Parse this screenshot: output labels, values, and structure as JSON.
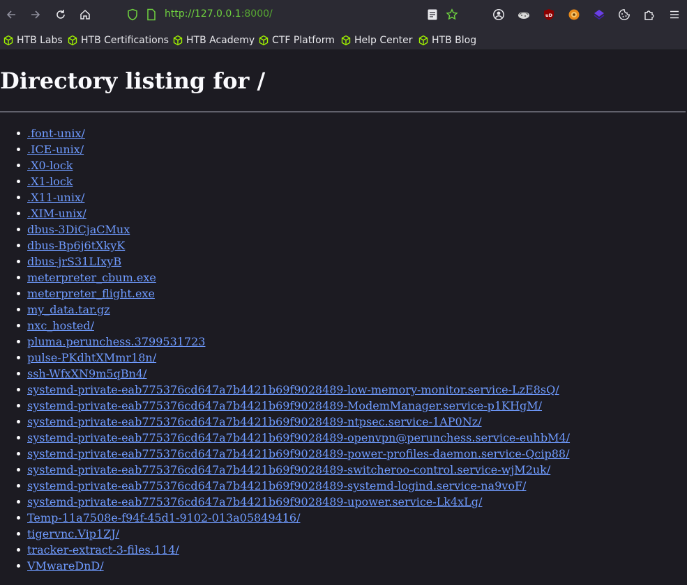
{
  "browser": {
    "url_host": "http://127.0.0.1",
    "url_port": ":8000/",
    "icons": {
      "back": "arrow-left-icon",
      "forward": "arrow-right-icon",
      "reload": "reload-icon",
      "home": "home-icon",
      "shield": "shield-icon",
      "page": "page-icon",
      "reader": "reader-view-icon",
      "bookmark_star": "star-icon",
      "account": "account-icon",
      "menu": "hamburger-menu-icon"
    }
  },
  "bookmarks": [
    {
      "label": "HTB Labs"
    },
    {
      "label": "HTB Certifications"
    },
    {
      "label": "HTB Academy"
    },
    {
      "label": "CTF Platform"
    },
    {
      "label": "Help Center"
    },
    {
      "label": "HTB Blog"
    }
  ],
  "page": {
    "title": "Directory listing for /",
    "entries": [
      ".font-unix/",
      ".ICE-unix/",
      ".X0-lock",
      ".X1-lock",
      ".X11-unix/",
      ".XIM-unix/",
      "dbus-3DiCjaCMux",
      "dbus-Bp6j6tXkyK",
      "dbus-jrS31LIxyB",
      "meterpreter_cbum.exe",
      "meterpreter_flight.exe",
      "my_data.tar.gz",
      "nxc_hosted/",
      "pluma.perunchess.3799531723",
      "pulse-PKdhtXMmr18n/",
      "ssh-WfxXN9m5qBn4/",
      "systemd-private-eab775376cd647a7b4421b69f9028489-low-memory-monitor.service-LzE8sQ/",
      "systemd-private-eab775376cd647a7b4421b69f9028489-ModemManager.service-p1KHgM/",
      "systemd-private-eab775376cd647a7b4421b69f9028489-ntpsec.service-1AP0Nz/",
      "systemd-private-eab775376cd647a7b4421b69f9028489-openvpn@perunchess.service-euhbM4/",
      "systemd-private-eab775376cd647a7b4421b69f9028489-power-profiles-daemon.service-Qcip88/",
      "systemd-private-eab775376cd647a7b4421b69f9028489-switcheroo-control.service-wjM2uk/",
      "systemd-private-eab775376cd647a7b4421b69f9028489-systemd-logind.service-na9voF/",
      "systemd-private-eab775376cd647a7b4421b69f9028489-upower.service-Lk4xLg/",
      "Temp-11a7508e-f94f-45d1-9102-013a05849416/",
      "tigervnc.Vip1ZJ/",
      "tracker-extract-3-files.114/",
      "VMwareDnD/"
    ]
  },
  "colors": {
    "link": "#6f9bff",
    "url_green": "#6fd23f",
    "bookmark_icon": "#9fef00",
    "page_bg": "#1c1b22",
    "chrome_bg": "#2b2a33"
  }
}
